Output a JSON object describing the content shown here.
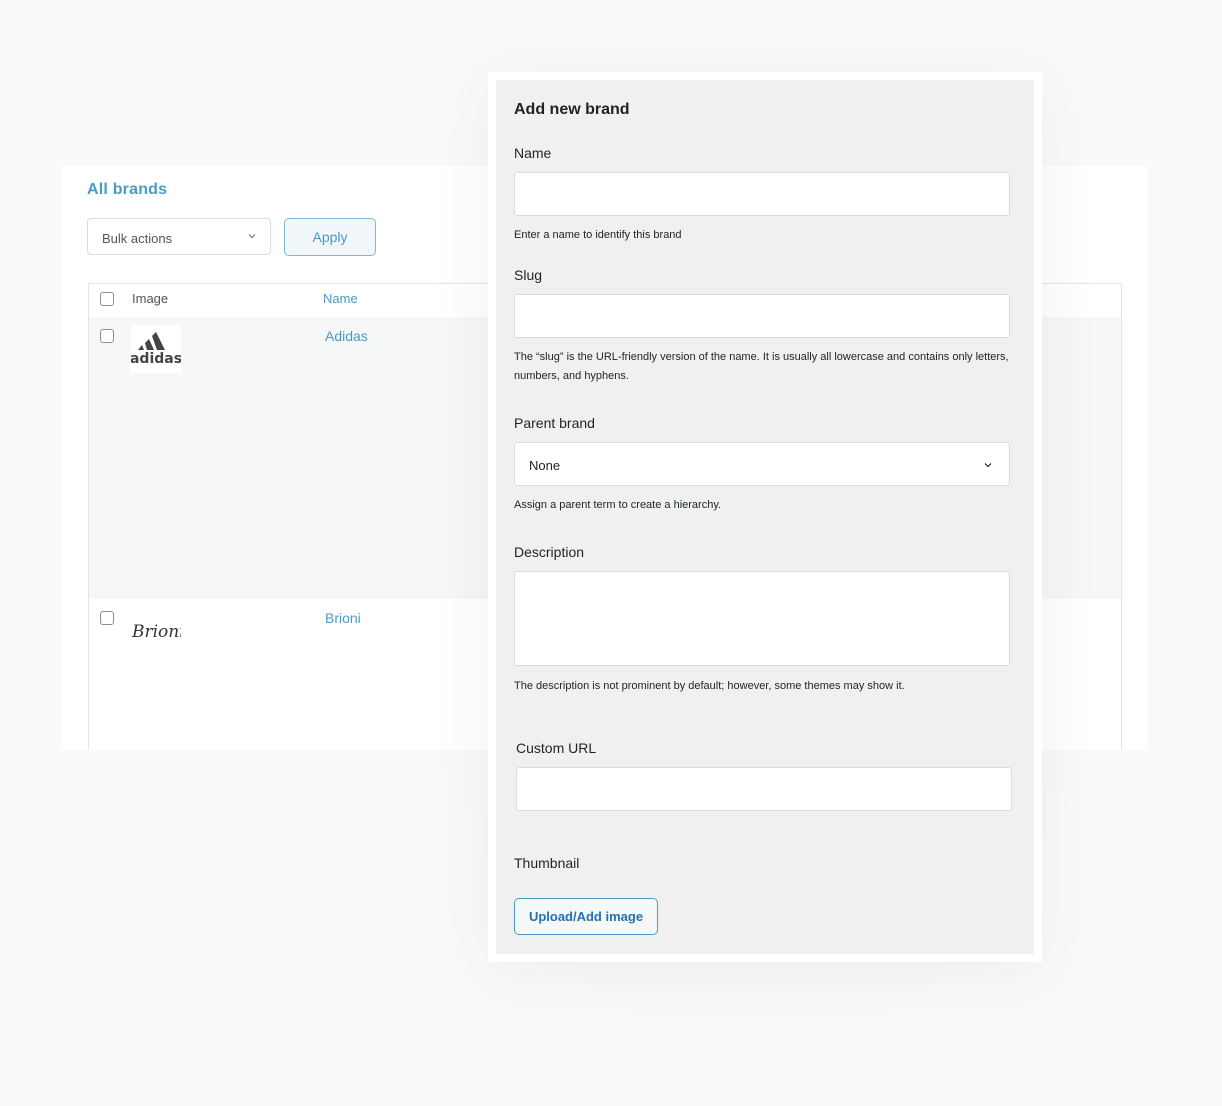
{
  "list": {
    "title": "All brands",
    "bulk_actions": {
      "selected": "Bulk actions"
    },
    "apply_label": "Apply",
    "columns": {
      "image": "Image",
      "name": "Name"
    },
    "rows": [
      {
        "name": "Adidas",
        "logo": "adidas"
      },
      {
        "name": "Brioni",
        "logo": "Brioni"
      }
    ]
  },
  "form": {
    "title": "Add new brand",
    "name": {
      "label": "Name",
      "value": "",
      "help": "Enter a name to identify this brand"
    },
    "slug": {
      "label": "Slug",
      "value": "",
      "help_line1": "The “slug” is the URL-friendly version of the name. It is usually all lowercase and contains only letters,",
      "help_line2": "numbers, and hyphens."
    },
    "parent": {
      "label": "Parent brand",
      "selected": "None",
      "help": "Assign a parent term to create a hierarchy."
    },
    "description": {
      "label": "Description",
      "value": "",
      "help": "The description is not prominent by default; however, some themes may show it."
    },
    "custom_url": {
      "label": "Custom URL",
      "value": ""
    },
    "thumbnail": {
      "label": "Thumbnail",
      "upload_label": "Upload/Add image"
    }
  },
  "colors": {
    "accent": "#4a9bc4",
    "link": "#2271b1",
    "form_bg": "#f0f0f1",
    "row_alt": "#f6f7f7"
  }
}
